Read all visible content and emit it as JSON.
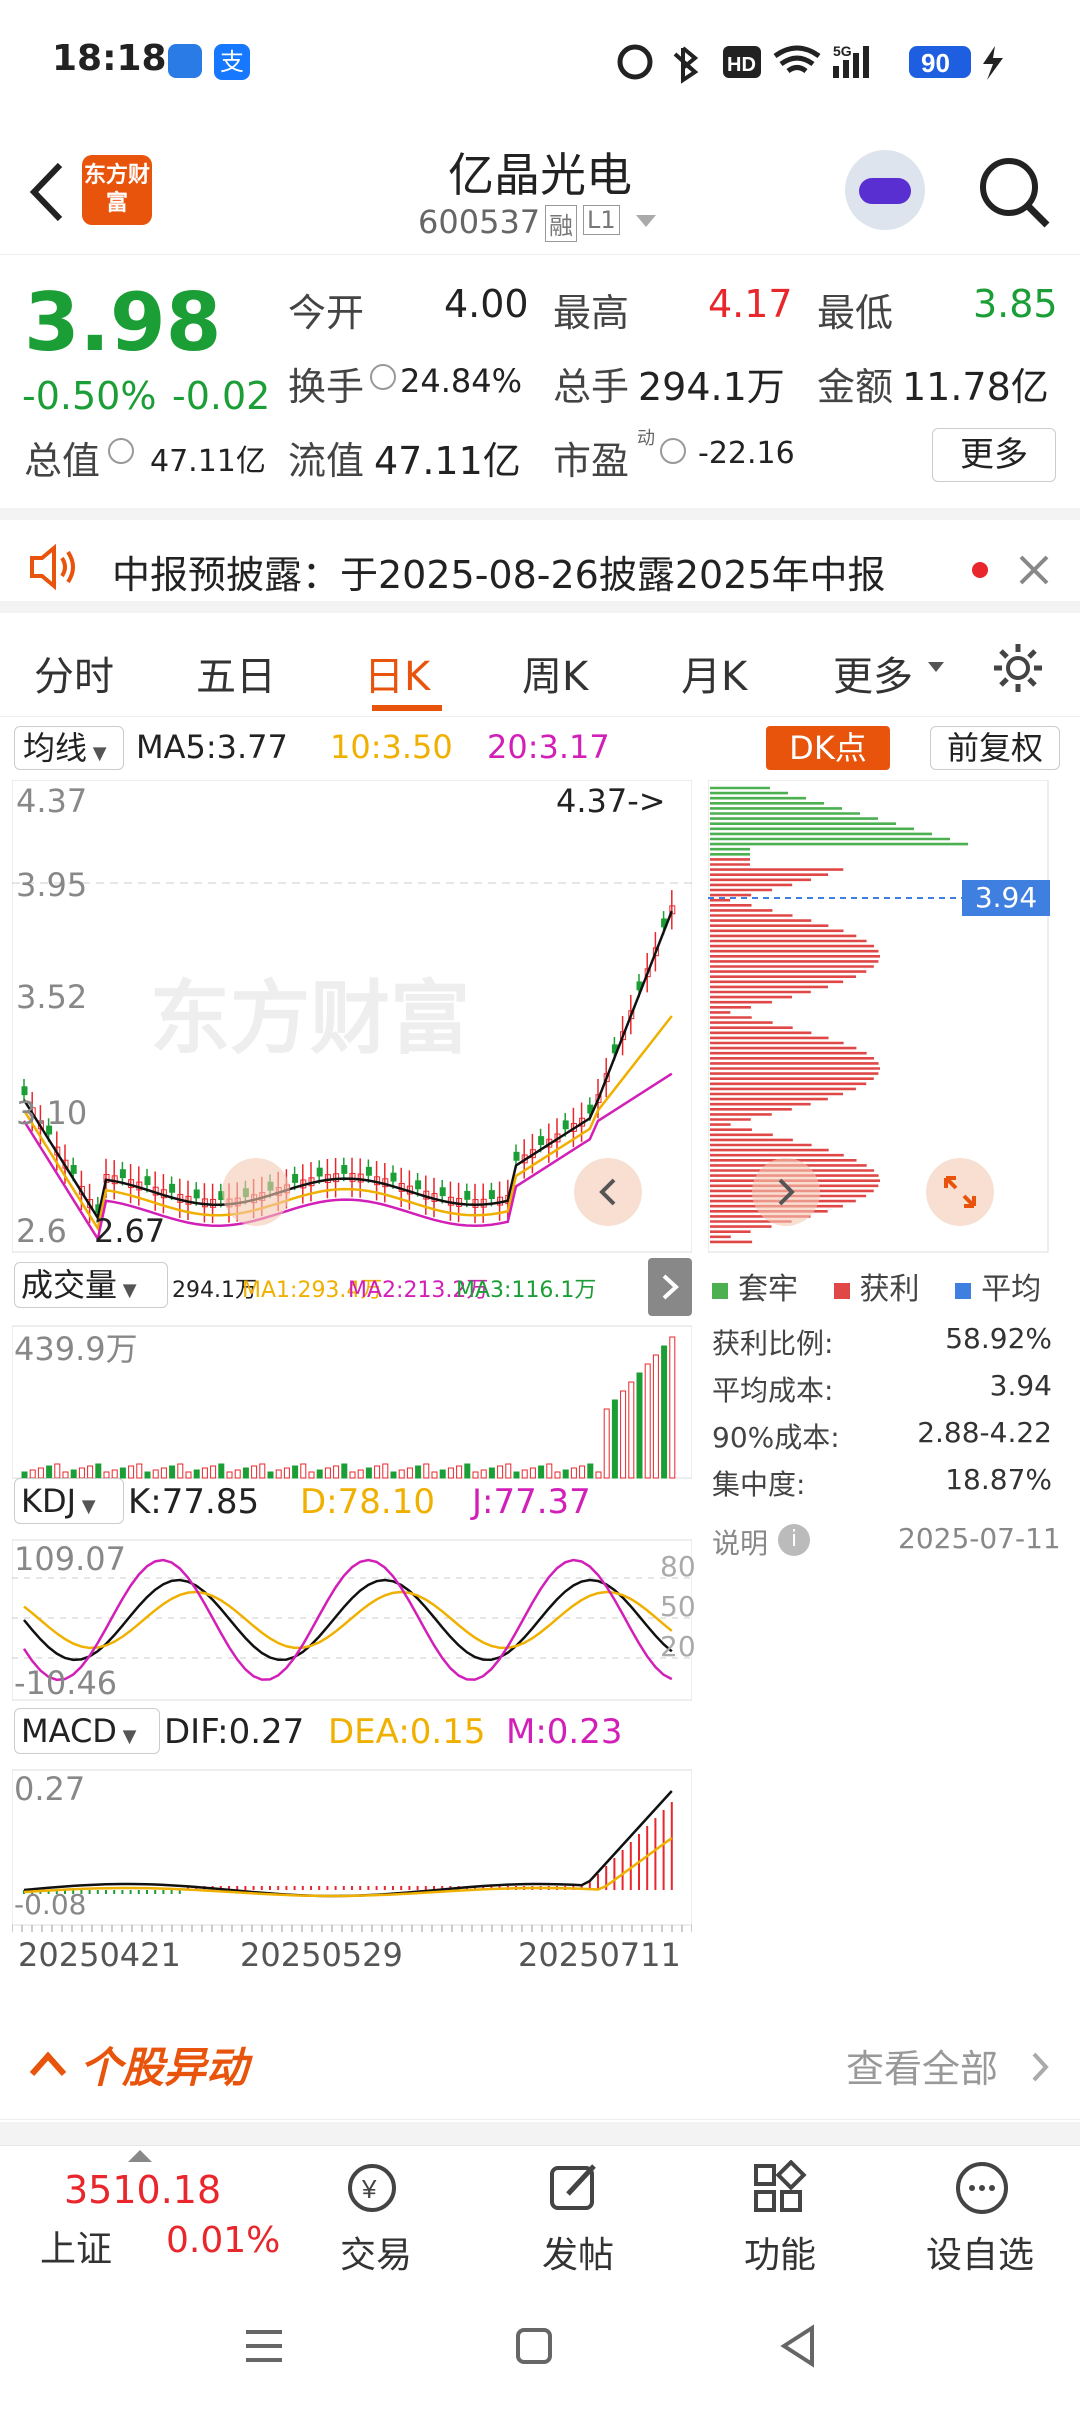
{
  "status": {
    "time": "18:18",
    "battery": "90",
    "network": "5G"
  },
  "nav": {
    "title": "亿晶光电",
    "code": "600537",
    "tag1": "融",
    "tag2": "L1",
    "logo": "东方财富"
  },
  "quote": {
    "price": "3.98",
    "change_pct": "-0.50%",
    "change": "-0.02",
    "open_label": "今开",
    "open": "4.00",
    "high_label": "最高",
    "high": "4.17",
    "low_label": "最低",
    "low": "3.85",
    "turnover_label": "换手",
    "turnover": "24.84%",
    "volume_label": "总手",
    "volume": "294.1万",
    "amount_label": "金额",
    "amount": "11.78亿",
    "mktcap_label": "总值",
    "mktcap": "47.11亿",
    "float_label": "流值",
    "float": "47.11亿",
    "pe_label": "市盈",
    "pe_sup": "动",
    "pe": "-22.16",
    "more_btn": "更多"
  },
  "notice": {
    "text": "中报预披露：于2025-08-26披露2025年中报"
  },
  "tabs": [
    "分时",
    "五日",
    "日K",
    "周K",
    "月K",
    "更多"
  ],
  "active_tab": 2,
  "kline": {
    "ma_select": "均线",
    "ma5": "MA5:3.77",
    "ma10": "10:3.50",
    "ma20": "20:3.17",
    "dk_btn": "DK点",
    "adj_btn": "前复权",
    "y_labels": [
      "4.37",
      "3.95",
      "3.52",
      "3.10",
      "2.6"
    ],
    "high_marker": "4.37->",
    "low_marker": "2.67",
    "watermark": "东方财富",
    "price_tag": "3.94"
  },
  "chip": {
    "legend": [
      "套牢",
      "获利",
      "平均"
    ],
    "rows": [
      {
        "label": "获利比例:",
        "value": "58.92%"
      },
      {
        "label": "平均成本:",
        "value": "3.94"
      },
      {
        "label": "90%成本:",
        "value": "2.88-4.22"
      },
      {
        "label": "集中度:",
        "value": "18.87%"
      }
    ],
    "note_label": "说明",
    "date": "2025-07-11"
  },
  "volume": {
    "select": "成交量",
    "v": "294.1万",
    "ma1": "MA1:293.4万",
    "ma2": "MA2:213.2万",
    "ma3": "MA3:116.1万",
    "ymax": "439.9万"
  },
  "kdj": {
    "select": "KDJ",
    "k": "K:77.85",
    "d": "D:78.10",
    "j": "J:77.37",
    "ymax": "109.07",
    "ymin": "-10.46",
    "levels": [
      "80",
      "50",
      "20"
    ]
  },
  "macd": {
    "select": "MACD",
    "dif": "DIF:0.27",
    "dea": "DEA:0.15",
    "m": "M:0.23",
    "ymax": "0.27",
    "ymin": "-0.08"
  },
  "dates": [
    "20250421",
    "20250529",
    "20250711"
  ],
  "movement": {
    "title": "个股异动",
    "view_all": "查看全部"
  },
  "bottom": {
    "index_value": "3510.18",
    "index_name": "上证",
    "index_change": "0.01%",
    "items": [
      "交易",
      "发帖",
      "功能",
      "设自选"
    ]
  },
  "colors": {
    "up": "#e8262b",
    "down": "#1c9e36",
    "accent": "#e8540c",
    "ma10": "#f0b000",
    "ma20": "#d21fb8"
  }
}
